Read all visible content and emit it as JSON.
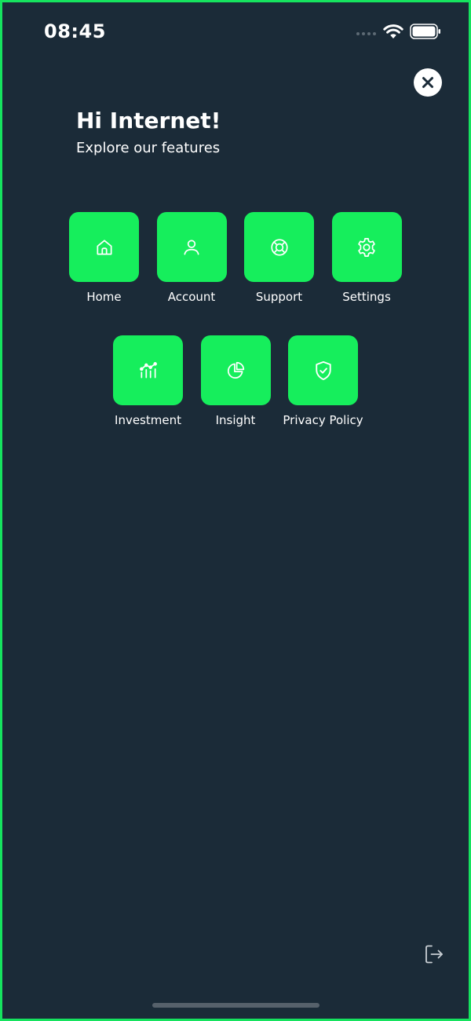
{
  "status_bar": {
    "time": "08:45"
  },
  "colors": {
    "background": "#1b2b38",
    "accent": "#16ee5c",
    "frame": "#16e35f",
    "text": "#ffffff"
  },
  "greeting": {
    "title": "Hi Internet!",
    "subtitle": "Explore our features"
  },
  "features": [
    {
      "label": "Home",
      "icon": "home-icon"
    },
    {
      "label": "Account",
      "icon": "user-icon"
    },
    {
      "label": "Support",
      "icon": "lifebuoy-icon"
    },
    {
      "label": "Settings",
      "icon": "gear-icon"
    },
    {
      "label": "Investment",
      "icon": "investment-chart-icon"
    },
    {
      "label": "Insight",
      "icon": "pie-chart-icon"
    },
    {
      "label": "Privacy Policy",
      "icon": "shield-check-icon"
    }
  ],
  "icons": {
    "close": "close-icon",
    "logout": "logout-icon"
  }
}
